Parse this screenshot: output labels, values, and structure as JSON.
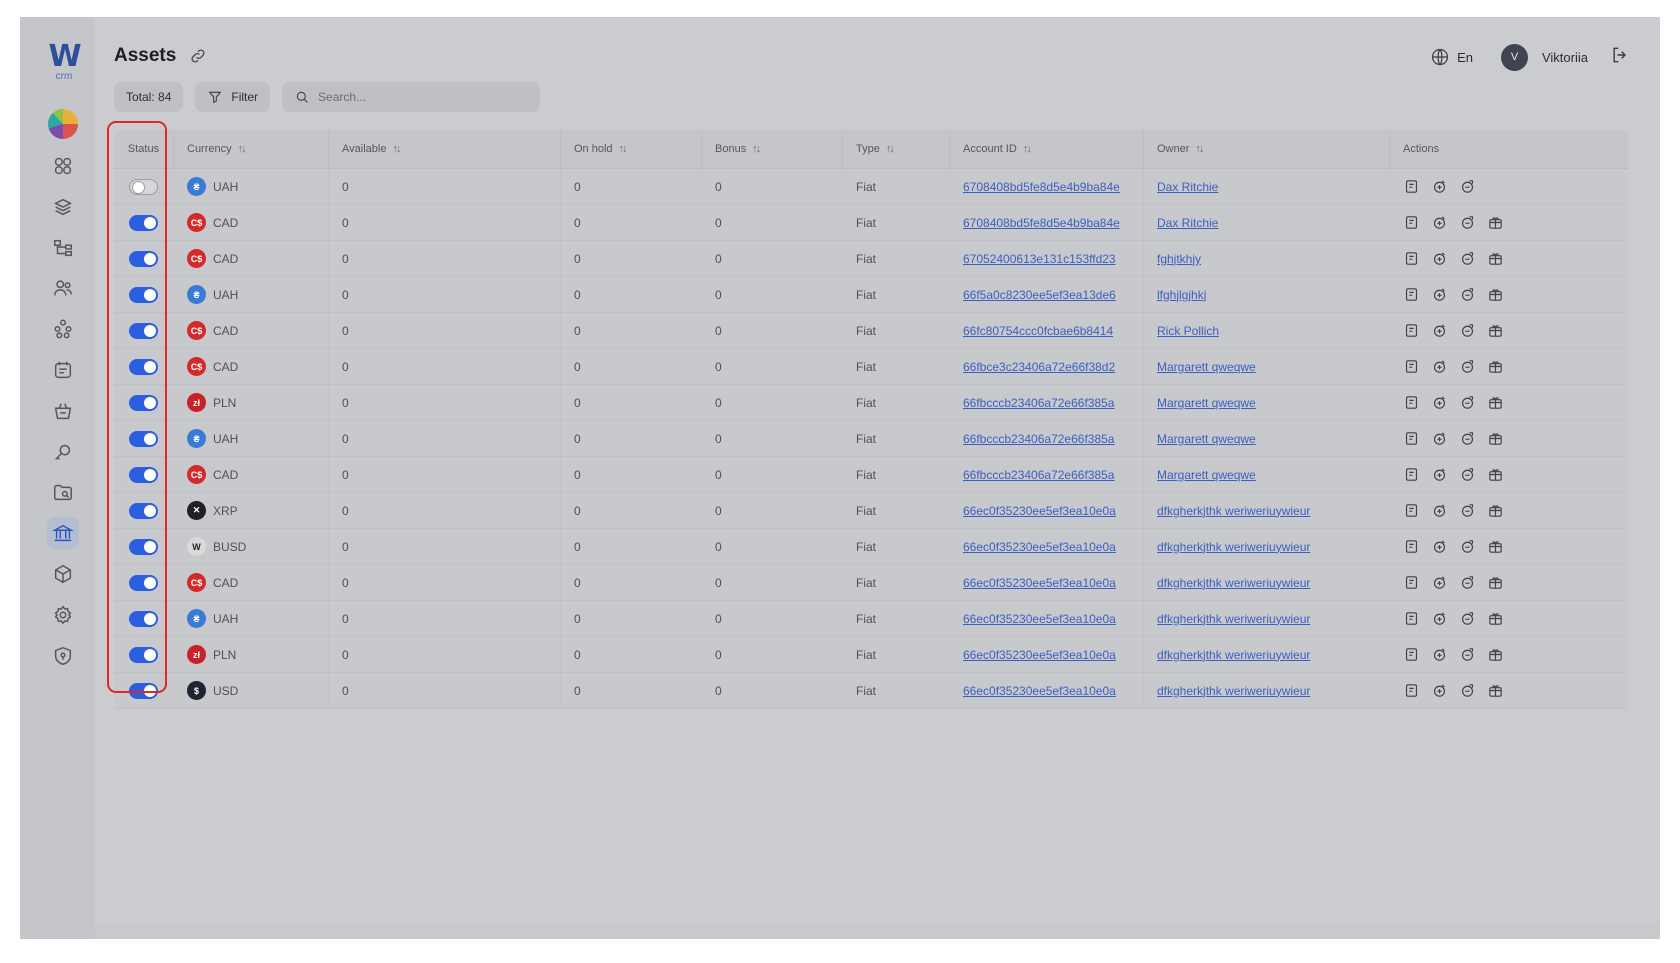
{
  "app": {
    "logo_text": "W",
    "logo_sub": "crm"
  },
  "sidebar": {
    "items": [
      {
        "icon": "dashboard-grid-icon"
      },
      {
        "icon": "layers-icon"
      },
      {
        "icon": "hierarchy-icon"
      },
      {
        "icon": "users-icon"
      },
      {
        "icon": "network-icon"
      },
      {
        "icon": "notes-icon"
      },
      {
        "icon": "basket-icon"
      },
      {
        "icon": "key-icon"
      },
      {
        "icon": "folder-search-icon"
      },
      {
        "icon": "bank-icon",
        "active": true
      },
      {
        "icon": "cube-icon"
      },
      {
        "icon": "settings-icon"
      },
      {
        "icon": "shield-icon"
      }
    ]
  },
  "header": {
    "title": "Assets",
    "lang": "En",
    "avatar_initial": "V",
    "username": "Viktoriia"
  },
  "toolbar": {
    "total_label": "Total: 84",
    "filter_label": "Filter",
    "search_placeholder": "Search..."
  },
  "table": {
    "columns": [
      "Status",
      "Currency",
      "Available",
      "On hold",
      "Bonus",
      "Type",
      "Account ID",
      "Owner",
      "Actions"
    ],
    "rows": [
      {
        "status": false,
        "currency": "UAH",
        "available": "0",
        "on_hold": "0",
        "bonus": "0",
        "type": "Fiat",
        "account_id": "6708408bd5fe8d5e4b9ba84e",
        "owner": "Dax Ritchie",
        "actions": 3
      },
      {
        "status": true,
        "currency": "CAD",
        "available": "0",
        "on_hold": "0",
        "bonus": "0",
        "type": "Fiat",
        "account_id": "6708408bd5fe8d5e4b9ba84e",
        "owner": "Dax Ritchie",
        "actions": 4
      },
      {
        "status": true,
        "currency": "CAD",
        "available": "0",
        "on_hold": "0",
        "bonus": "0",
        "type": "Fiat",
        "account_id": "67052400613e131c153ffd23",
        "owner": "fghjtkhjy",
        "actions": 4
      },
      {
        "status": true,
        "currency": "UAH",
        "available": "0",
        "on_hold": "0",
        "bonus": "0",
        "type": "Fiat",
        "account_id": "66f5a0c8230ee5ef3ea13de6",
        "owner": "lfghjlgjhkj",
        "actions": 4
      },
      {
        "status": true,
        "currency": "CAD",
        "available": "0",
        "on_hold": "0",
        "bonus": "0",
        "type": "Fiat",
        "account_id": "66fc80754ccc0fcbae6b8414",
        "owner": "Rick Pollich",
        "actions": 4
      },
      {
        "status": true,
        "currency": "CAD",
        "available": "0",
        "on_hold": "0",
        "bonus": "0",
        "type": "Fiat",
        "account_id": "66fbce3c23406a72e66f38d2",
        "owner": "Margarett qweqwe",
        "actions": 4
      },
      {
        "status": true,
        "currency": "PLN",
        "available": "0",
        "on_hold": "0",
        "bonus": "0",
        "type": "Fiat",
        "account_id": "66fbcccb23406a72e66f385a",
        "owner": "Margarett qweqwe",
        "actions": 4
      },
      {
        "status": true,
        "currency": "UAH",
        "available": "0",
        "on_hold": "0",
        "bonus": "0",
        "type": "Fiat",
        "account_id": "66fbcccb23406a72e66f385a",
        "owner": "Margarett qweqwe",
        "actions": 4
      },
      {
        "status": true,
        "currency": "CAD",
        "available": "0",
        "on_hold": "0",
        "bonus": "0",
        "type": "Fiat",
        "account_id": "66fbcccb23406a72e66f385a",
        "owner": "Margarett qweqwe",
        "actions": 4
      },
      {
        "status": true,
        "currency": "XRP",
        "available": "0",
        "on_hold": "0",
        "bonus": "0",
        "type": "Fiat",
        "account_id": "66ec0f35230ee5ef3ea10e0a",
        "owner": "dfkgherkjthk weriweriuywieur",
        "actions": 4
      },
      {
        "status": true,
        "currency": "BUSD",
        "available": "0",
        "on_hold": "0",
        "bonus": "0",
        "type": "Fiat",
        "account_id": "66ec0f35230ee5ef3ea10e0a",
        "owner": "dfkgherkjthk weriweriuywieur",
        "actions": 4
      },
      {
        "status": true,
        "currency": "CAD",
        "available": "0",
        "on_hold": "0",
        "bonus": "0",
        "type": "Fiat",
        "account_id": "66ec0f35230ee5ef3ea10e0a",
        "owner": "dfkgherkjthk weriweriuywieur",
        "actions": 4
      },
      {
        "status": true,
        "currency": "UAH",
        "available": "0",
        "on_hold": "0",
        "bonus": "0",
        "type": "Fiat",
        "account_id": "66ec0f35230ee5ef3ea10e0a",
        "owner": "dfkgherkjthk weriweriuywieur",
        "actions": 4
      },
      {
        "status": true,
        "currency": "PLN",
        "available": "0",
        "on_hold": "0",
        "bonus": "0",
        "type": "Fiat",
        "account_id": "66ec0f35230ee5ef3ea10e0a",
        "owner": "dfkgherkjthk weriweriuywieur",
        "actions": 4
      },
      {
        "status": true,
        "currency": "USD",
        "available": "0",
        "on_hold": "0",
        "bonus": "0",
        "type": "Fiat",
        "account_id": "66ec0f35230ee5ef3ea10e0a",
        "owner": "dfkgherkjthk weriweriuywieur",
        "actions": 4
      }
    ]
  },
  "coins": {
    "UAH": {
      "glyph": "₴",
      "color": "#3a7bd5"
    },
    "CAD": {
      "glyph": "C$",
      "color": "#d42a2a"
    },
    "PLN": {
      "glyph": "zł",
      "color": "#c9212a"
    },
    "XRP": {
      "glyph": "✕",
      "color": "#1f2126"
    },
    "BUSD": {
      "glyph": "W",
      "color": "#d9d9d9"
    },
    "USD": {
      "glyph": "$",
      "color": "#1f2433"
    }
  },
  "colors": {
    "accent": "#2c5fe0",
    "link": "#3a5fc4",
    "highlight": "#e0262b"
  }
}
